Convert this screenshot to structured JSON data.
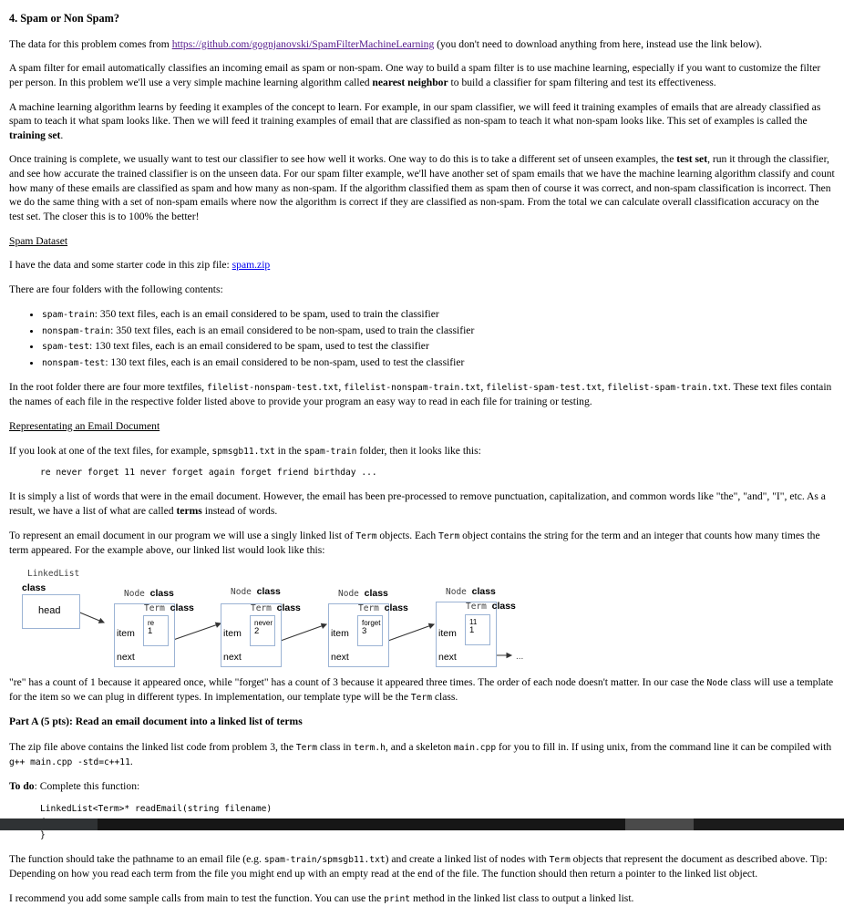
{
  "document": {
    "heading": "4. Spam or Non Spam?",
    "intro_prefix": "The data for this problem comes from ",
    "intro_link": "https://github.com/gognjanovski/SpamFilterMachineLearning",
    "intro_suffix": " (you don't need to download anything from here, instead use the link below).",
    "para_spam_filter_1": "A spam filter for email automatically classifies an incoming email as spam or non-spam. One way to build a spam filter is to use machine learning, especially if you want to customize the filter per person. In this problem we'll use a very simple machine learning algorithm called ",
    "para_spam_filter_bold": "nearest neighbor",
    "para_spam_filter_2": " to build a classifier for spam filtering and test its effectiveness.",
    "para_ml_1": "A machine learning algorithm learns by feeding it examples of the concept to learn. For example, in our spam classifier, we will feed it training examples of emails that are already classified as spam to teach it what spam looks like. Then we will feed it training examples of email that are classified as non-spam to teach it what non-spam looks like. This set of examples is called the ",
    "para_ml_bold": "training set",
    "para_ml_2": ".",
    "para_test_1": "Once training is complete, we usually want to test our classifier to see how well it works. One way to do this is to take a different set of unseen examples, the ",
    "para_test_bold": "test set",
    "para_test_2": ", run it through the classifier, and see how accurate the trained classifier is on the unseen data. For our spam filter example, we'll have another set of spam emails that we have the machine learning algorithm classify and count how many of these emails are classified as spam and how many as non-spam. If the algorithm classified them as spam then of course it was correct, and non-spam classification is incorrect. Then we do the same thing with a set of non-spam emails where now the algorithm is correct if they are classified as non-spam. From the total we can calculate overall classification accuracy on the test set. The closer this is to 100% the better!",
    "section_spam_dataset": "Spam Dataset",
    "para_zip_prefix": "I have the data and some starter code in this zip file: ",
    "zip_link": "spam.zip",
    "para_four_folders": "There are four folders with the following contents:",
    "folders": [
      {
        "name": "spam-train",
        "desc": ": 350 text files, each is an email considered to be spam, used to train the classifier"
      },
      {
        "name": "nonspam-train",
        "desc": ": 350 text files, each is an email considered to be non-spam, used to train the classifier"
      },
      {
        "name": "spam-test",
        "desc": ": 130 text files, each is an email considered to be spam, used to test the classifier"
      },
      {
        "name": "nonspam-test",
        "desc": ": 130 text files, each is an email considered to be non-spam, used to test the classifier"
      }
    ],
    "para_textfiles_1": "In the root folder there are four more textfiles, ",
    "textfile_1": "filelist-nonspam-test.txt",
    "textfile_sep_1": ", ",
    "textfile_2": "filelist-nonspam-train.txt",
    "textfile_sep_2": ", ",
    "textfile_3": "filelist-spam-test.txt",
    "textfile_sep_3": ", ",
    "textfile_4": "filelist-spam-train.txt",
    "para_textfiles_2": ". These text files contain the names of each file in the respective folder listed above to provide your program an easy way to read in each file for training or testing.",
    "section_representing": "Representating an Email Document",
    "para_look_1": "If you look at one of the text files, for example, ",
    "para_look_file": "spmsgb11.txt",
    "para_look_2": " in the ",
    "para_look_folder": "spam-train",
    "para_look_3": " folder, then it looks like this:",
    "sample_email_line": "re never forget 11 never forget again forget friend birthday ...",
    "para_terms_1": "It is simply a list of words that were in the email document. However, the email has been pre-processed to remove punctuation, capitalization, and common words like \"the\", \"and\", \"I\", etc. As a result, we have a list of what are called ",
    "para_terms_bold": "terms",
    "para_terms_2": " instead of words.",
    "para_represent_1": "To represent an email document in our program we will use a singly linked list of ",
    "para_represent_code1": "Term",
    "para_represent_2": " objects. Each ",
    "para_represent_code2": "Term",
    "para_represent_3": " object contains the string for the term and an integer that counts how many times the term appeared. For the example above, our linked list would look like this:",
    "para_counts_1": "\"re\" has a count of 1 because it appeared once, while \"forget\" has a count of 3 because it appeared three times. The order of each node doesn't matter. In our case the ",
    "para_counts_code1": "Node",
    "para_counts_2": " class will use a template for the item so we can plug in different types. In implementation, our template type will be the ",
    "para_counts_code2": "Term",
    "para_counts_3": " class.",
    "part_a_heading": "Part A (5 pts): Read an email document into a linked list of terms",
    "para_zipfile_1": "The zip file above contains the linked list code from problem 3, the ",
    "para_zipfile_code1": "Term",
    "para_zipfile_2": " class in ",
    "para_zipfile_code2": "term.h",
    "para_zipfile_3": ", and a skeleton ",
    "para_zipfile_code3": "main.cpp",
    "para_zipfile_4": " for you to fill in. If using unix, from the command line it can be compiled with ",
    "para_zipfile_code4": "g++ main.cpp -std=c++11",
    "para_zipfile_5": ".",
    "todo_bold": "To do",
    "todo_rest": ": Complete this function:",
    "code_block": "LinkedList<Term>* readEmail(string filename)\n{\n}",
    "para_function_1": "The function should take the pathname to an email file (e.g. ",
    "para_function_code": "spam-train/spmsgb11.txt",
    "para_function_2": ") and create a linked list of nodes with ",
    "para_function_code2": "Term",
    "para_function_3": " objects that represent the document as described above. Tip: Depending on how you read each term from the file you might end up with an empty read at the end of the file. The function should then return a pointer to the linked list object.",
    "para_recommend_1": "I recommend you add some sample calls from main to test the function. You can use the ",
    "para_recommend_code": "print",
    "para_recommend_2": " method in the linked list class to output a linked list."
  },
  "diagram": {
    "linkedlist_label_line1": "LinkedList",
    "linkedlist_label_line2": "class",
    "head_label": "head",
    "node_label": "Node",
    "class_word": "class",
    "term_label": "Term",
    "item_label": "item",
    "next_label": "next",
    "ellipsis": "...",
    "nodes": [
      {
        "term": "re",
        "count": "1"
      },
      {
        "term": "never",
        "count": "2"
      },
      {
        "term": "forget",
        "count": "3"
      },
      {
        "term": "11",
        "count": "1"
      }
    ],
    "box_border_color": "#9bb3d4"
  }
}
